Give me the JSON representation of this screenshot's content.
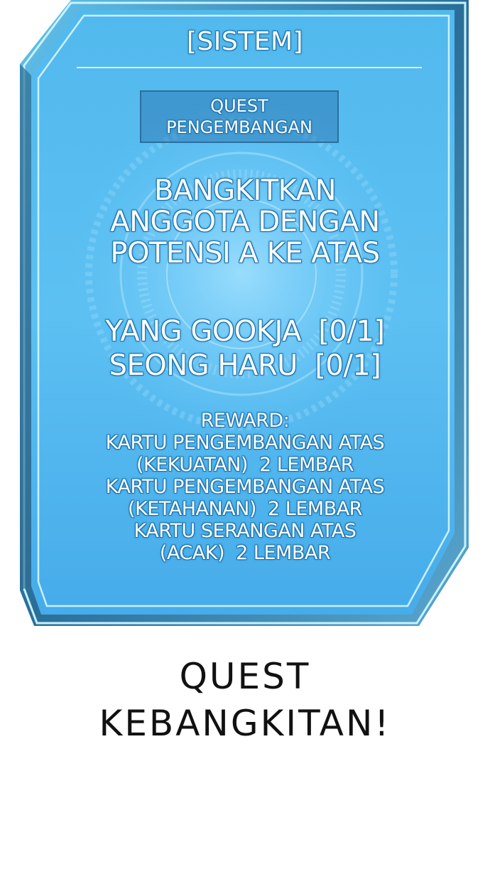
{
  "panel": {
    "header": "[SISTEM]",
    "quest_type_line1": "QUEST",
    "quest_type_line2": "PENGEMBANGAN",
    "objective_lines": [
      "BANGKITKAN",
      "ANGGOTA DENGAN",
      "POTENSI A KE ATAS"
    ],
    "progress_lines": [
      "YANG GOOKJA  [0/1]",
      "SEONG HARU  [0/1]"
    ],
    "reward_lines": [
      "REWARD:",
      "KARTU PENGEMBANGAN ATAS",
      "(KEKUATAN)  2 LEMBAR",
      "KARTU PENGEMBANGAN ATAS",
      "(KETAHANAN)  2 LEMBAR",
      "KARTU SERANGAN ATAS",
      "(ACAK)  2 LEMBAR"
    ]
  },
  "caption": {
    "line1": "QUEST",
    "line2": "KEBANGKITAN!"
  },
  "colors": {
    "panel_blue": "#4fb6ec",
    "panel_light": "#8fd6fb",
    "frame_dark": "#2b5e80",
    "frame_cyan": "#bff0ff",
    "text_outline": "#1f78b4"
  }
}
